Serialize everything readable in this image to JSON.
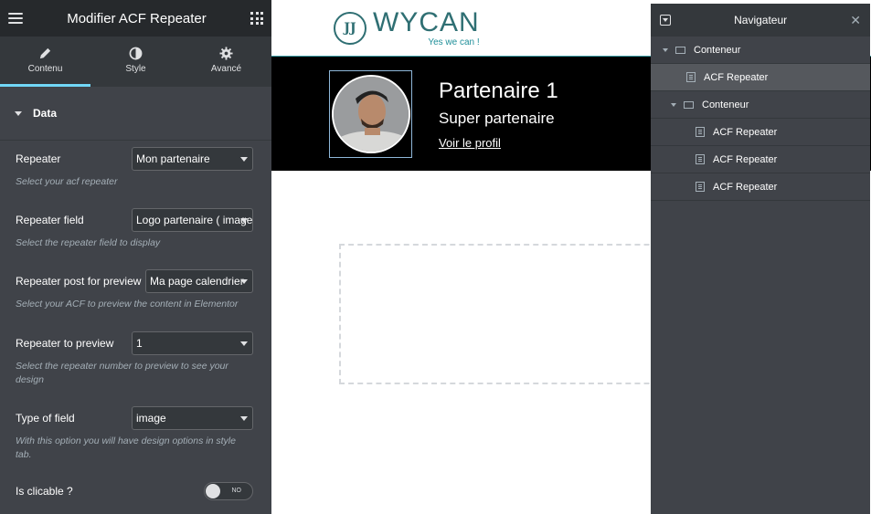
{
  "panel": {
    "title": "Modifier ACF Repeater",
    "tabs": [
      {
        "label": "Contenu",
        "icon": "pencil-icon",
        "active": true
      },
      {
        "label": "Style",
        "icon": "contrast-icon",
        "active": false
      },
      {
        "label": "Avancé",
        "icon": "gear-icon",
        "active": false
      }
    ],
    "section_title": "Data",
    "controls": {
      "repeater": {
        "label": "Repeater",
        "value": "Mon partenaire",
        "description": "Select your acf repeater"
      },
      "repeater_field": {
        "label": "Repeater field",
        "value": "Logo partenaire ( image )",
        "description": "Select the repeater field to display"
      },
      "post_preview": {
        "label": "Repeater post for preview",
        "value": "Ma page calendrier",
        "description": "Select your ACF to preview the content in Elementor"
      },
      "repeater_preview": {
        "label": "Repeater to preview",
        "value": "1",
        "description": "Select the repeater number to preview to see your design"
      },
      "field_type": {
        "label": "Type of field",
        "value": "image",
        "description": "With this option you will have design options in style tab."
      },
      "clickable": {
        "label": "Is clicable ?",
        "state": "NO"
      }
    },
    "colors": {
      "accent": "#71d7f7",
      "panel_bg": "#404349",
      "header_bg": "#26292c"
    }
  },
  "preview": {
    "logo": {
      "word": "WYCAN",
      "tagline": "Yes we can !",
      "mark": "JJ",
      "color": "#2f6f73"
    },
    "partner": {
      "name": "Partenaire 1",
      "subtitle": "Super partenaire",
      "link": "Voir le profil"
    }
  },
  "navigator": {
    "title": "Navigateur",
    "items": [
      {
        "label": "Conteneur",
        "type": "container",
        "expanded": true
      },
      {
        "label": "ACF Repeater",
        "type": "widget",
        "selected": true
      },
      {
        "label": "Conteneur",
        "type": "container",
        "expanded": true
      },
      {
        "label": "ACF Repeater",
        "type": "widget",
        "selected": false
      },
      {
        "label": "ACF Repeater",
        "type": "widget",
        "selected": false
      },
      {
        "label": "ACF Repeater",
        "type": "widget",
        "selected": false
      }
    ]
  }
}
